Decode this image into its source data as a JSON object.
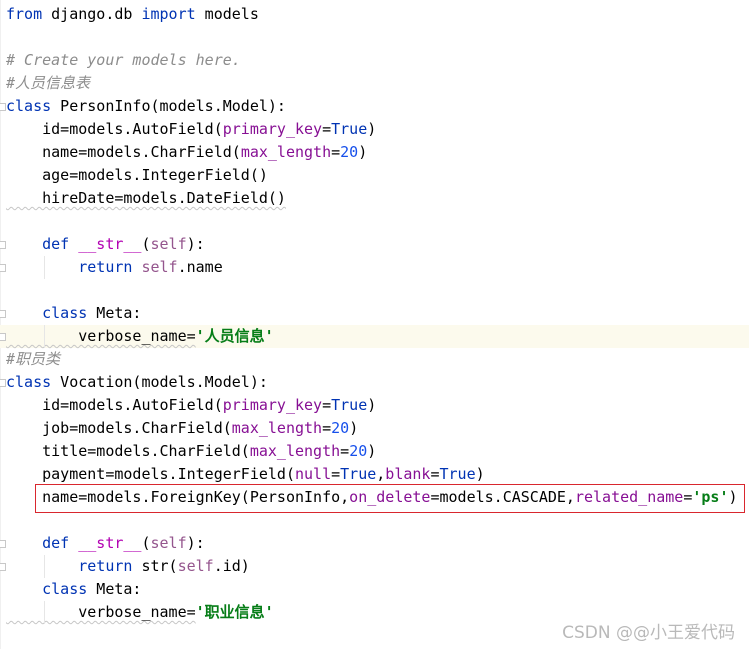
{
  "editor": {
    "lines": [
      [
        {
          "t": "from",
          "c": "kw"
        },
        {
          "t": " django.db "
        },
        {
          "t": "import",
          "c": "kw"
        },
        {
          "t": " models"
        }
      ],
      [],
      [
        {
          "t": "# Create your models here.",
          "c": "comment"
        }
      ],
      [
        {
          "t": "#人员信息表",
          "c": "comment"
        }
      ],
      [
        {
          "t": "class",
          "c": "kw"
        },
        {
          "t": " PersonInfo(models.Model):"
        }
      ],
      [
        {
          "t": "    id=models.AutoField("
        },
        {
          "t": "primary_key",
          "c": "param"
        },
        {
          "t": "="
        },
        {
          "t": "True",
          "c": "kw"
        },
        {
          "t": ")"
        }
      ],
      [
        {
          "t": "    name=models.CharField("
        },
        {
          "t": "max_length",
          "c": "param"
        },
        {
          "t": "="
        },
        {
          "t": "20",
          "c": "num"
        },
        {
          "t": ")"
        }
      ],
      [
        {
          "t": "    age=models.IntegerField()"
        }
      ],
      [
        {
          "t": "    hireDate=models.DateField()"
        }
      ],
      [],
      [
        {
          "t": "    "
        },
        {
          "t": "def",
          "c": "kw"
        },
        {
          "t": " "
        },
        {
          "t": "__str__",
          "c": "dunder"
        },
        {
          "t": "("
        },
        {
          "t": "self",
          "c": "selfkw"
        },
        {
          "t": "):"
        }
      ],
      [
        {
          "t": "        "
        },
        {
          "t": "return",
          "c": "kw"
        },
        {
          "t": " "
        },
        {
          "t": "self",
          "c": "selfkw"
        },
        {
          "t": ".name"
        }
      ],
      [],
      [
        {
          "t": "    "
        },
        {
          "t": "class",
          "c": "kw"
        },
        {
          "t": " Meta:"
        }
      ],
      [
        {
          "t": "        verbose_name="
        },
        {
          "t": "'人员信息'",
          "c": "str"
        }
      ],
      [
        {
          "t": "#职员类",
          "c": "comment"
        }
      ],
      [
        {
          "t": "class",
          "c": "kw"
        },
        {
          "t": " Vocation(models.Model):"
        }
      ],
      [
        {
          "t": "    id=models.AutoField("
        },
        {
          "t": "primary_key",
          "c": "param"
        },
        {
          "t": "="
        },
        {
          "t": "True",
          "c": "kw"
        },
        {
          "t": ")"
        }
      ],
      [
        {
          "t": "    job=models.CharField("
        },
        {
          "t": "max_length",
          "c": "param"
        },
        {
          "t": "="
        },
        {
          "t": "20",
          "c": "num"
        },
        {
          "t": ")"
        }
      ],
      [
        {
          "t": "    title=models.CharField("
        },
        {
          "t": "max_length",
          "c": "param"
        },
        {
          "t": "="
        },
        {
          "t": "20",
          "c": "num"
        },
        {
          "t": ")"
        }
      ],
      [
        {
          "t": "    payment=models.IntegerField("
        },
        {
          "t": "null",
          "c": "param"
        },
        {
          "t": "="
        },
        {
          "t": "True",
          "c": "kw"
        },
        {
          "t": ","
        },
        {
          "t": "blank",
          "c": "param"
        },
        {
          "t": "="
        },
        {
          "t": "True",
          "c": "kw"
        },
        {
          "t": ")"
        }
      ],
      [
        {
          "t": "    name=models.ForeignKey(PersonInfo,"
        },
        {
          "t": "on_delete",
          "c": "param"
        },
        {
          "t": "=models.CASCADE,"
        },
        {
          "t": "related_name",
          "c": "param"
        },
        {
          "t": "="
        },
        {
          "t": "'ps'",
          "c": "str"
        },
        {
          "t": ")"
        }
      ],
      [],
      [
        {
          "t": "    "
        },
        {
          "t": "def",
          "c": "kw"
        },
        {
          "t": " "
        },
        {
          "t": "__str__",
          "c": "dunder"
        },
        {
          "t": "("
        },
        {
          "t": "self",
          "c": "selfkw"
        },
        {
          "t": "):"
        }
      ],
      [
        {
          "t": "        "
        },
        {
          "t": "return",
          "c": "kw"
        },
        {
          "t": " str("
        },
        {
          "t": "self",
          "c": "selfkw"
        },
        {
          "t": ".id)"
        }
      ],
      [
        {
          "t": "    "
        },
        {
          "t": "class",
          "c": "kw"
        },
        {
          "t": " Meta:"
        }
      ],
      [
        {
          "t": "        verbose_name="
        },
        {
          "t": "'职业信息'",
          "c": "str"
        }
      ]
    ],
    "caret_line_index": 14,
    "highlighted_line_index": 21,
    "colors": {
      "keyword": "#0033b3",
      "parameter": "#871094",
      "self": "#94558d",
      "dunder": "#b200b2",
      "number": "#1750eb",
      "string": "#067d17",
      "comment": "#8c8c8c",
      "highlight_box": "#d9272e",
      "caret_row": "#fcfaed"
    }
  },
  "watermark": {
    "text": "CSDN @@小王爱代码"
  }
}
